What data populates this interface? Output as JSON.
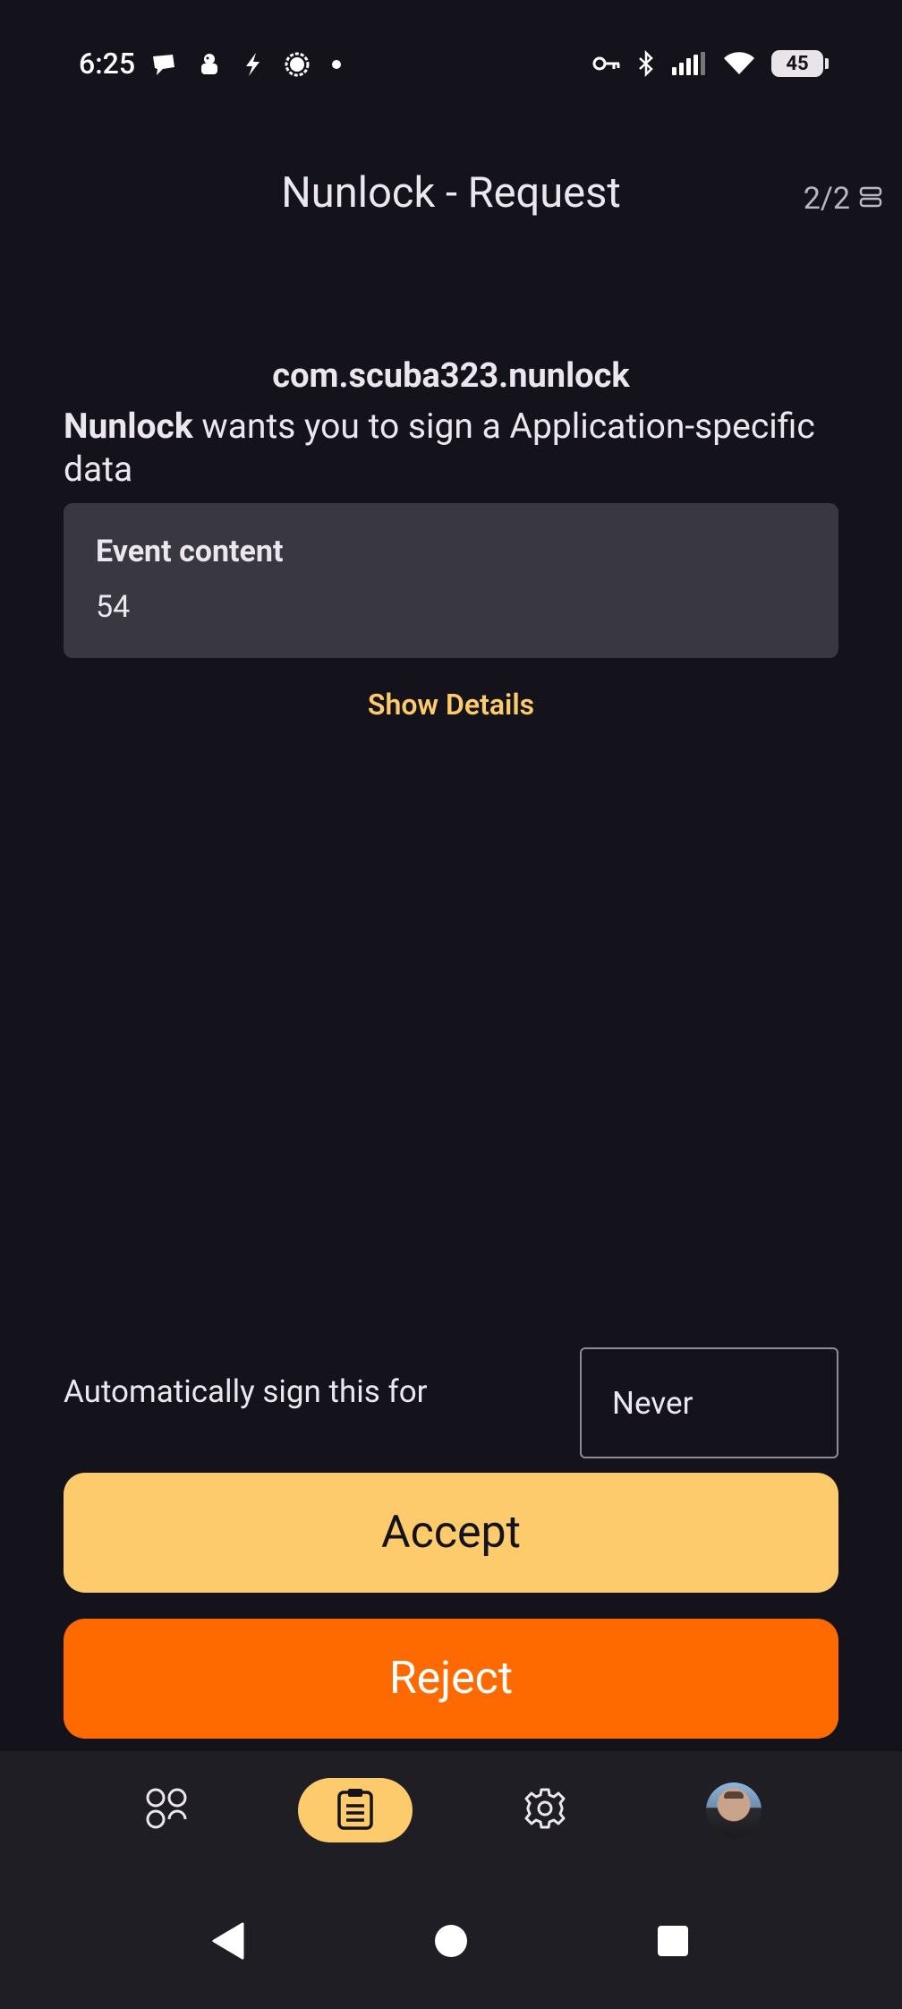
{
  "status_bar": {
    "time": "6:25",
    "battery": "45",
    "left_icons": [
      "message-bubble-icon",
      "android-robot-icon",
      "bolt-icon",
      "signal-chat-icon",
      "dot-icon"
    ],
    "right_icons": [
      "vpn-key-icon",
      "bluetooth-icon",
      "cell-signal-icon",
      "wifi-icon",
      "battery-icon"
    ]
  },
  "app_bar": {
    "title": "Nunlock - Request",
    "page_counter": "2/2"
  },
  "request": {
    "package_name": "com.scuba323.nunlock",
    "app_name": "Nunlock",
    "action_text": " wants you to sign a Application-specific data"
  },
  "event_card": {
    "label": "Event content",
    "value": "54"
  },
  "show_details_label": "Show Details",
  "auto_sign": {
    "label": "Automatically sign this for",
    "value": "Never"
  },
  "buttons": {
    "accept": "Accept",
    "reject": "Reject"
  },
  "bottom_nav": {
    "items": [
      {
        "icon": "apps-icon",
        "active": false
      },
      {
        "icon": "clipboard-icon",
        "active": true
      },
      {
        "icon": "gear-icon",
        "active": false
      },
      {
        "icon": "avatar",
        "active": false
      }
    ]
  },
  "colors": {
    "background": "#14121a",
    "accent": "#fdcb6b",
    "reject": "#ff6a00",
    "card": "#39373f",
    "nav": "#1f1e25"
  }
}
